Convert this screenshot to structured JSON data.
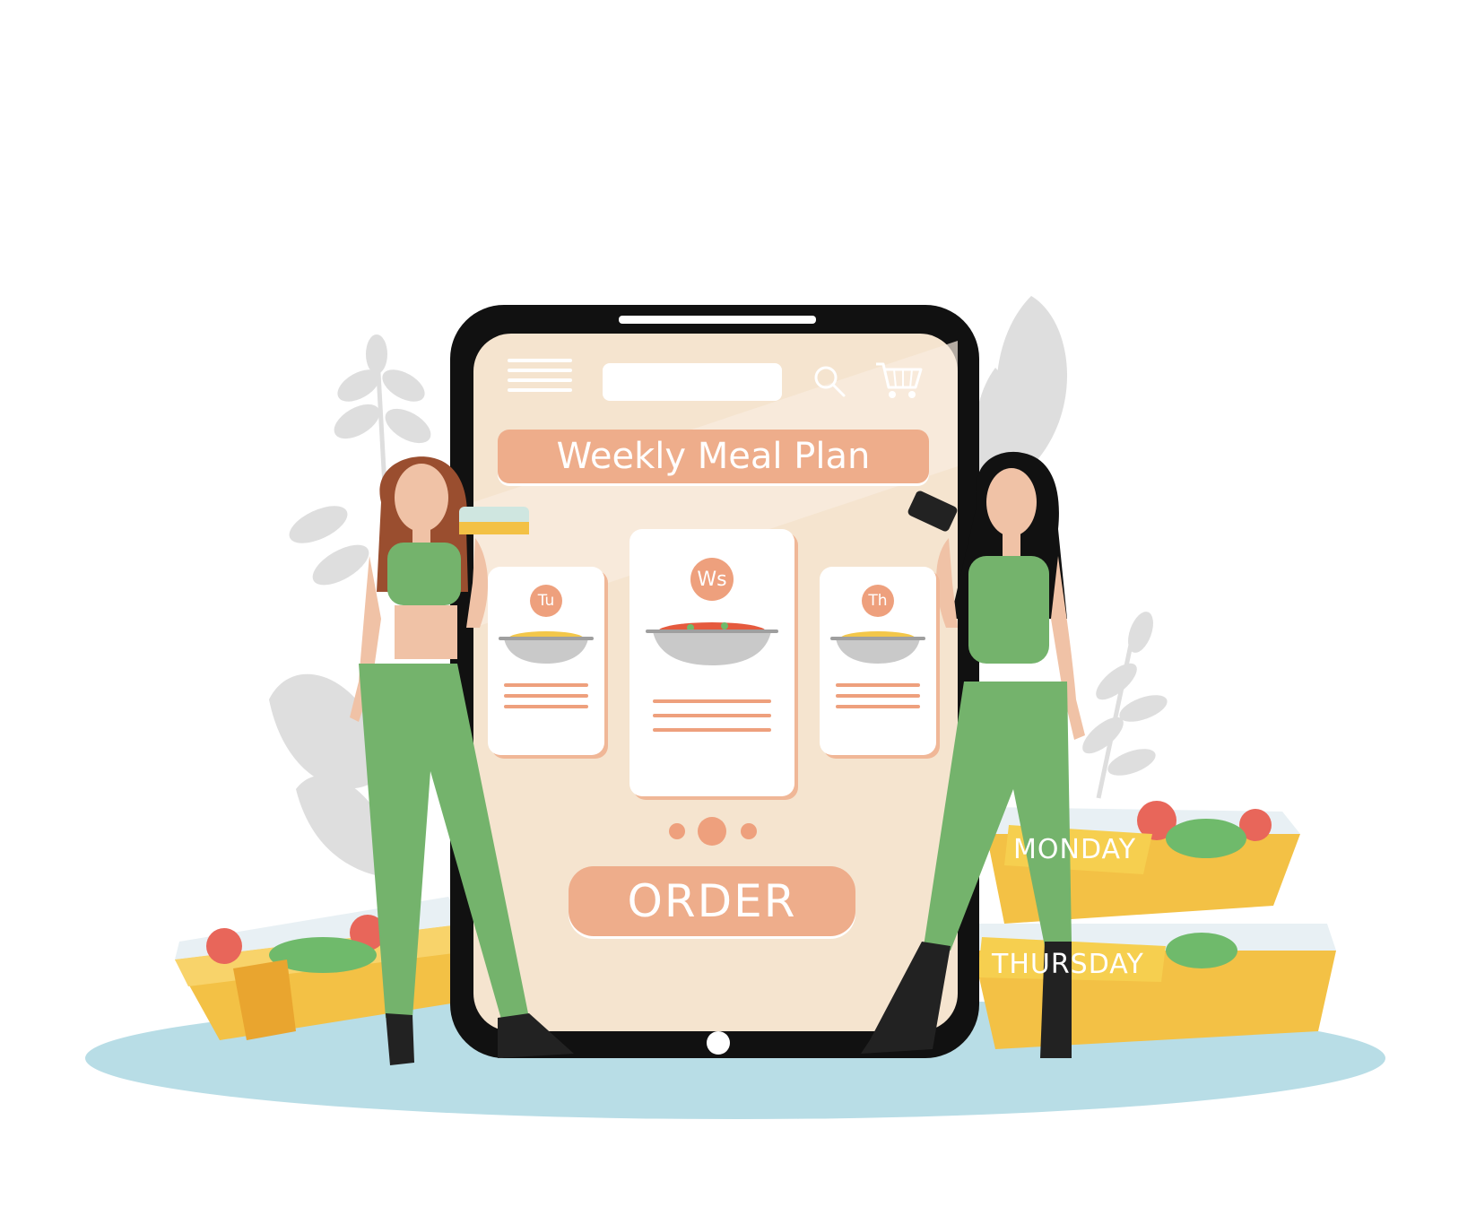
{
  "app": {
    "banner_title": "Weekly Meal Plan",
    "search": {
      "value": "",
      "placeholder": ""
    },
    "icons": {
      "menu": "hamburger-menu-icon",
      "search": "search-icon",
      "cart": "shopping-cart-icon",
      "home": "home-button-icon"
    },
    "cards": [
      {
        "day": "Tu",
        "dish": "yellow rice bowl"
      },
      {
        "day": "Ws",
        "dish": "tomato stir-fry bowl"
      },
      {
        "day": "Th",
        "dish": "yellow rice bowl"
      }
    ],
    "carousel": {
      "pages": 3,
      "active": 2
    },
    "order_label": "ORDER"
  },
  "boxes": [
    {
      "label": "MONDAY"
    },
    {
      "label": "THURSDAY"
    }
  ],
  "colors": {
    "screen": "#f5e4cf",
    "accent": "#eead8b",
    "badge": "#eea07d",
    "outfit": "#74b36c",
    "outfit_dark": "#5a9a55",
    "box": "#f3c145",
    "floor": "#b8dde6",
    "leaves": "#dcdcdc"
  }
}
